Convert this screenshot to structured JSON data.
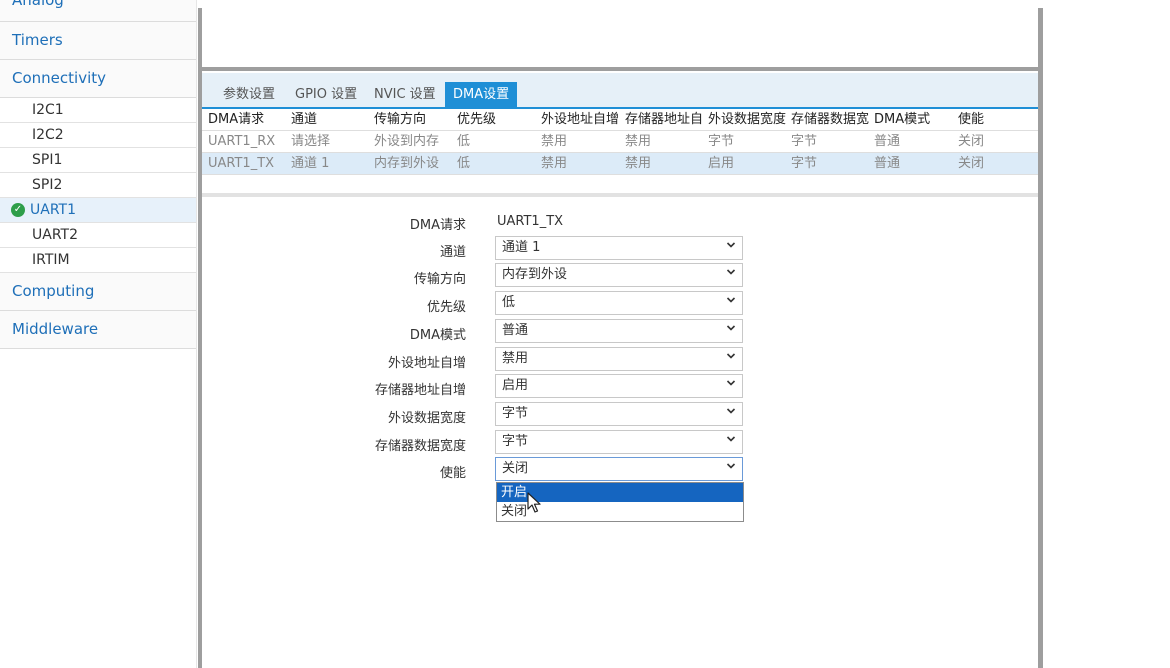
{
  "sidebar": {
    "partial_category": "Analog",
    "categories_top": [
      "Timers",
      "Connectivity"
    ],
    "connectivity_items": [
      "I2C1",
      "I2C2",
      "SPI1",
      "SPI2",
      "UART1",
      "UART2",
      "IRTIM"
    ],
    "selected_item": "UART1",
    "categories_bottom": [
      "Computing",
      "Middleware"
    ]
  },
  "tabs": [
    "参数设置",
    "GPIO 设置",
    "NVIC 设置",
    "DMA设置"
  ],
  "active_tab": "DMA设置",
  "table": {
    "headers": [
      "DMA请求",
      "通道",
      "传输方向",
      "优先级",
      "外设地址自增",
      "存储器地址自",
      "外设数据宽度",
      "存储器数据宽",
      "DMA模式",
      "使能"
    ],
    "rows": [
      [
        "UART1_RX",
        "请选择",
        "外设到内存",
        "低",
        "禁用",
        "禁用",
        "字节",
        "字节",
        "普通",
        "关闭"
      ],
      [
        "UART1_TX",
        "通道 1",
        "内存到外设",
        "低",
        "禁用",
        "禁用",
        "启用",
        "字节",
        "普通",
        "关闭"
      ]
    ],
    "selected_row": 1
  },
  "form": {
    "request_label": "DMA请求",
    "request_value": "UART1_TX",
    "fields": [
      {
        "label": "通道",
        "value": "通道 1"
      },
      {
        "label": "传输方向",
        "value": "内存到外设"
      },
      {
        "label": "优先级",
        "value": "低"
      },
      {
        "label": "DMA模式",
        "value": "普通"
      },
      {
        "label": "外设地址自增",
        "value": "禁用"
      },
      {
        "label": "存储器地址自增",
        "value": "启用"
      },
      {
        "label": "外设数据宽度",
        "value": "字节"
      },
      {
        "label": "存储器数据宽度",
        "value": "字节"
      },
      {
        "label": "使能",
        "value": "关闭"
      }
    ]
  },
  "dropdown": {
    "options": [
      "开启",
      "关闭"
    ],
    "highlighted": "开启"
  },
  "colors": {
    "accent": "#1f8fd6",
    "link": "#1e6fb8",
    "success": "#2e9e49",
    "dropdown_highlight": "#1565c0"
  }
}
